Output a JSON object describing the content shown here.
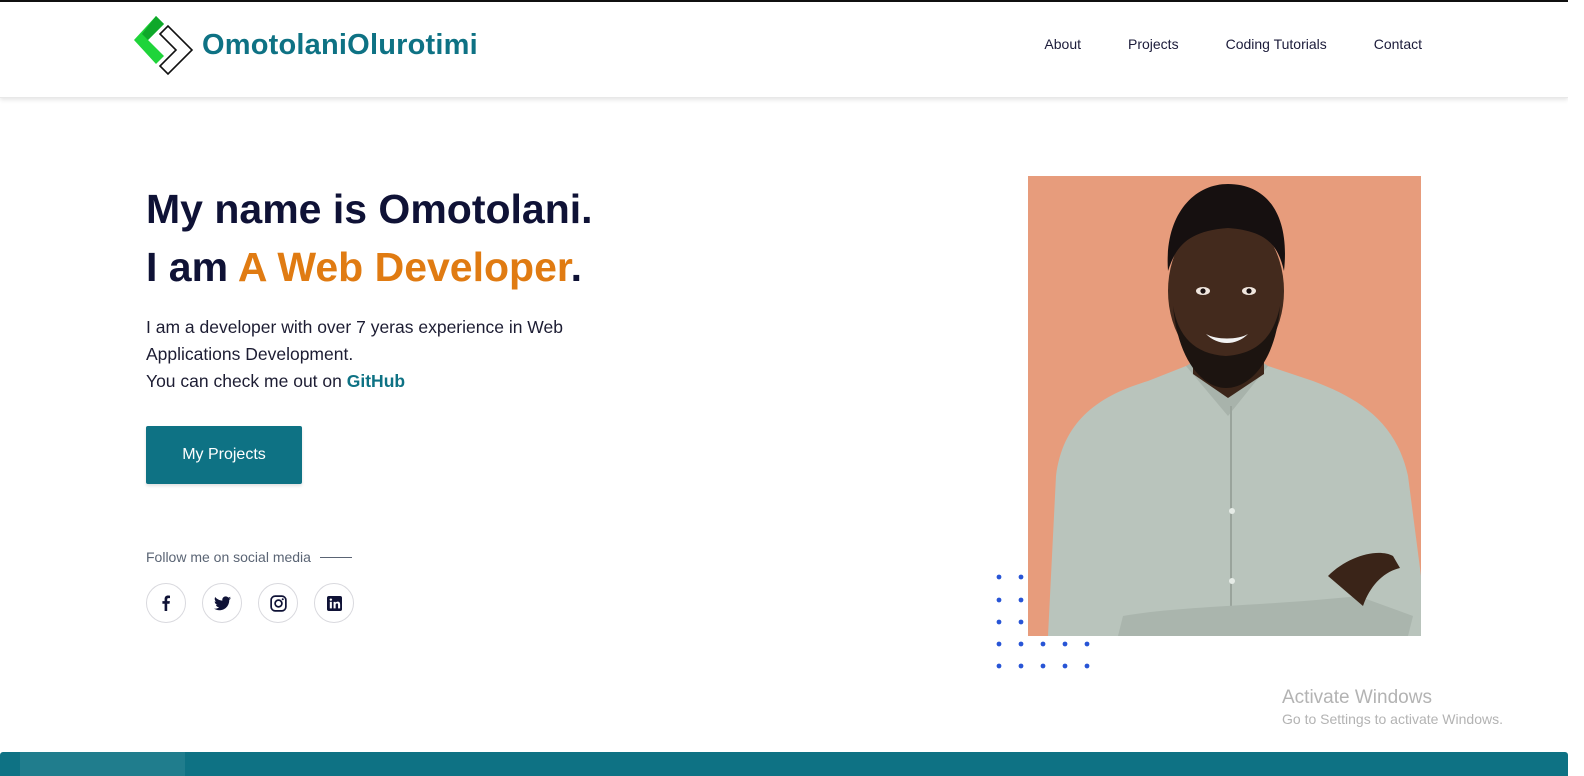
{
  "brand": {
    "name": "OmotolaniOlurotimi",
    "icon": "code-brackets-logo-icon",
    "color": "#0e7284"
  },
  "nav": {
    "items": [
      {
        "label": "About"
      },
      {
        "label": "Projects"
      },
      {
        "label": "Coding Tutorials"
      },
      {
        "label": "Contact"
      }
    ]
  },
  "hero": {
    "line1": "My name is Omotolani.",
    "line2_prefix": "I am ",
    "line2_accent": "A Web Developer",
    "line2_suffix": ".",
    "accent_color": "#e07b12",
    "desc_line1": "I am a developer with over 7 yeras experience in Web Applications Development.",
    "desc_line2_prefix": "You can check me out on ",
    "desc_link": "GitHub",
    "cta_label": "My Projects"
  },
  "social": {
    "label": "Follow me on social media",
    "icons": [
      "facebook-icon",
      "twitter-icon",
      "instagram-icon",
      "linkedin-icon"
    ]
  },
  "watermark": {
    "title": "Activate Windows",
    "subtitle": "Go to Settings to activate Windows."
  }
}
